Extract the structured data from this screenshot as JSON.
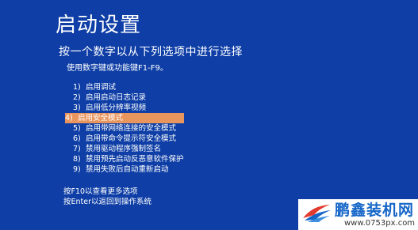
{
  "screen": {
    "title": "启动设置",
    "subtitle": "按一个数字以从下列选项中进行选择",
    "hint": "使用数字键或功能键F1-F9。",
    "options": [
      {
        "number": "1)",
        "label": "启用调试"
      },
      {
        "number": "2)",
        "label": "启用启动日志记录"
      },
      {
        "number": "3)",
        "label": "启用低分辨率视频"
      },
      {
        "number": "4)",
        "label": "启用安全模式"
      },
      {
        "number": "5)",
        "label": "启用带网络连接的安全模式"
      },
      {
        "number": "6)",
        "label": "启用带命令提示符安全模式"
      },
      {
        "number": "7)",
        "label": "禁用驱动程序强制签名"
      },
      {
        "number": "8)",
        "label": "禁用预先启动反恶意软件保护"
      },
      {
        "number": "9)",
        "label": "禁用失败后自动重新启动"
      }
    ],
    "selected_index": 3,
    "footer": {
      "more_options": "按F10以查看更多选项",
      "return": "按Enter以返回到操作系统"
    }
  },
  "watermark": {
    "name": "鹏鑫装机网",
    "url": "www.0753px.com"
  },
  "colors": {
    "background": "#0F3FA6",
    "highlight": "#E9955E",
    "text": "#FFFFFF",
    "watermark_text": "#1566C8"
  }
}
